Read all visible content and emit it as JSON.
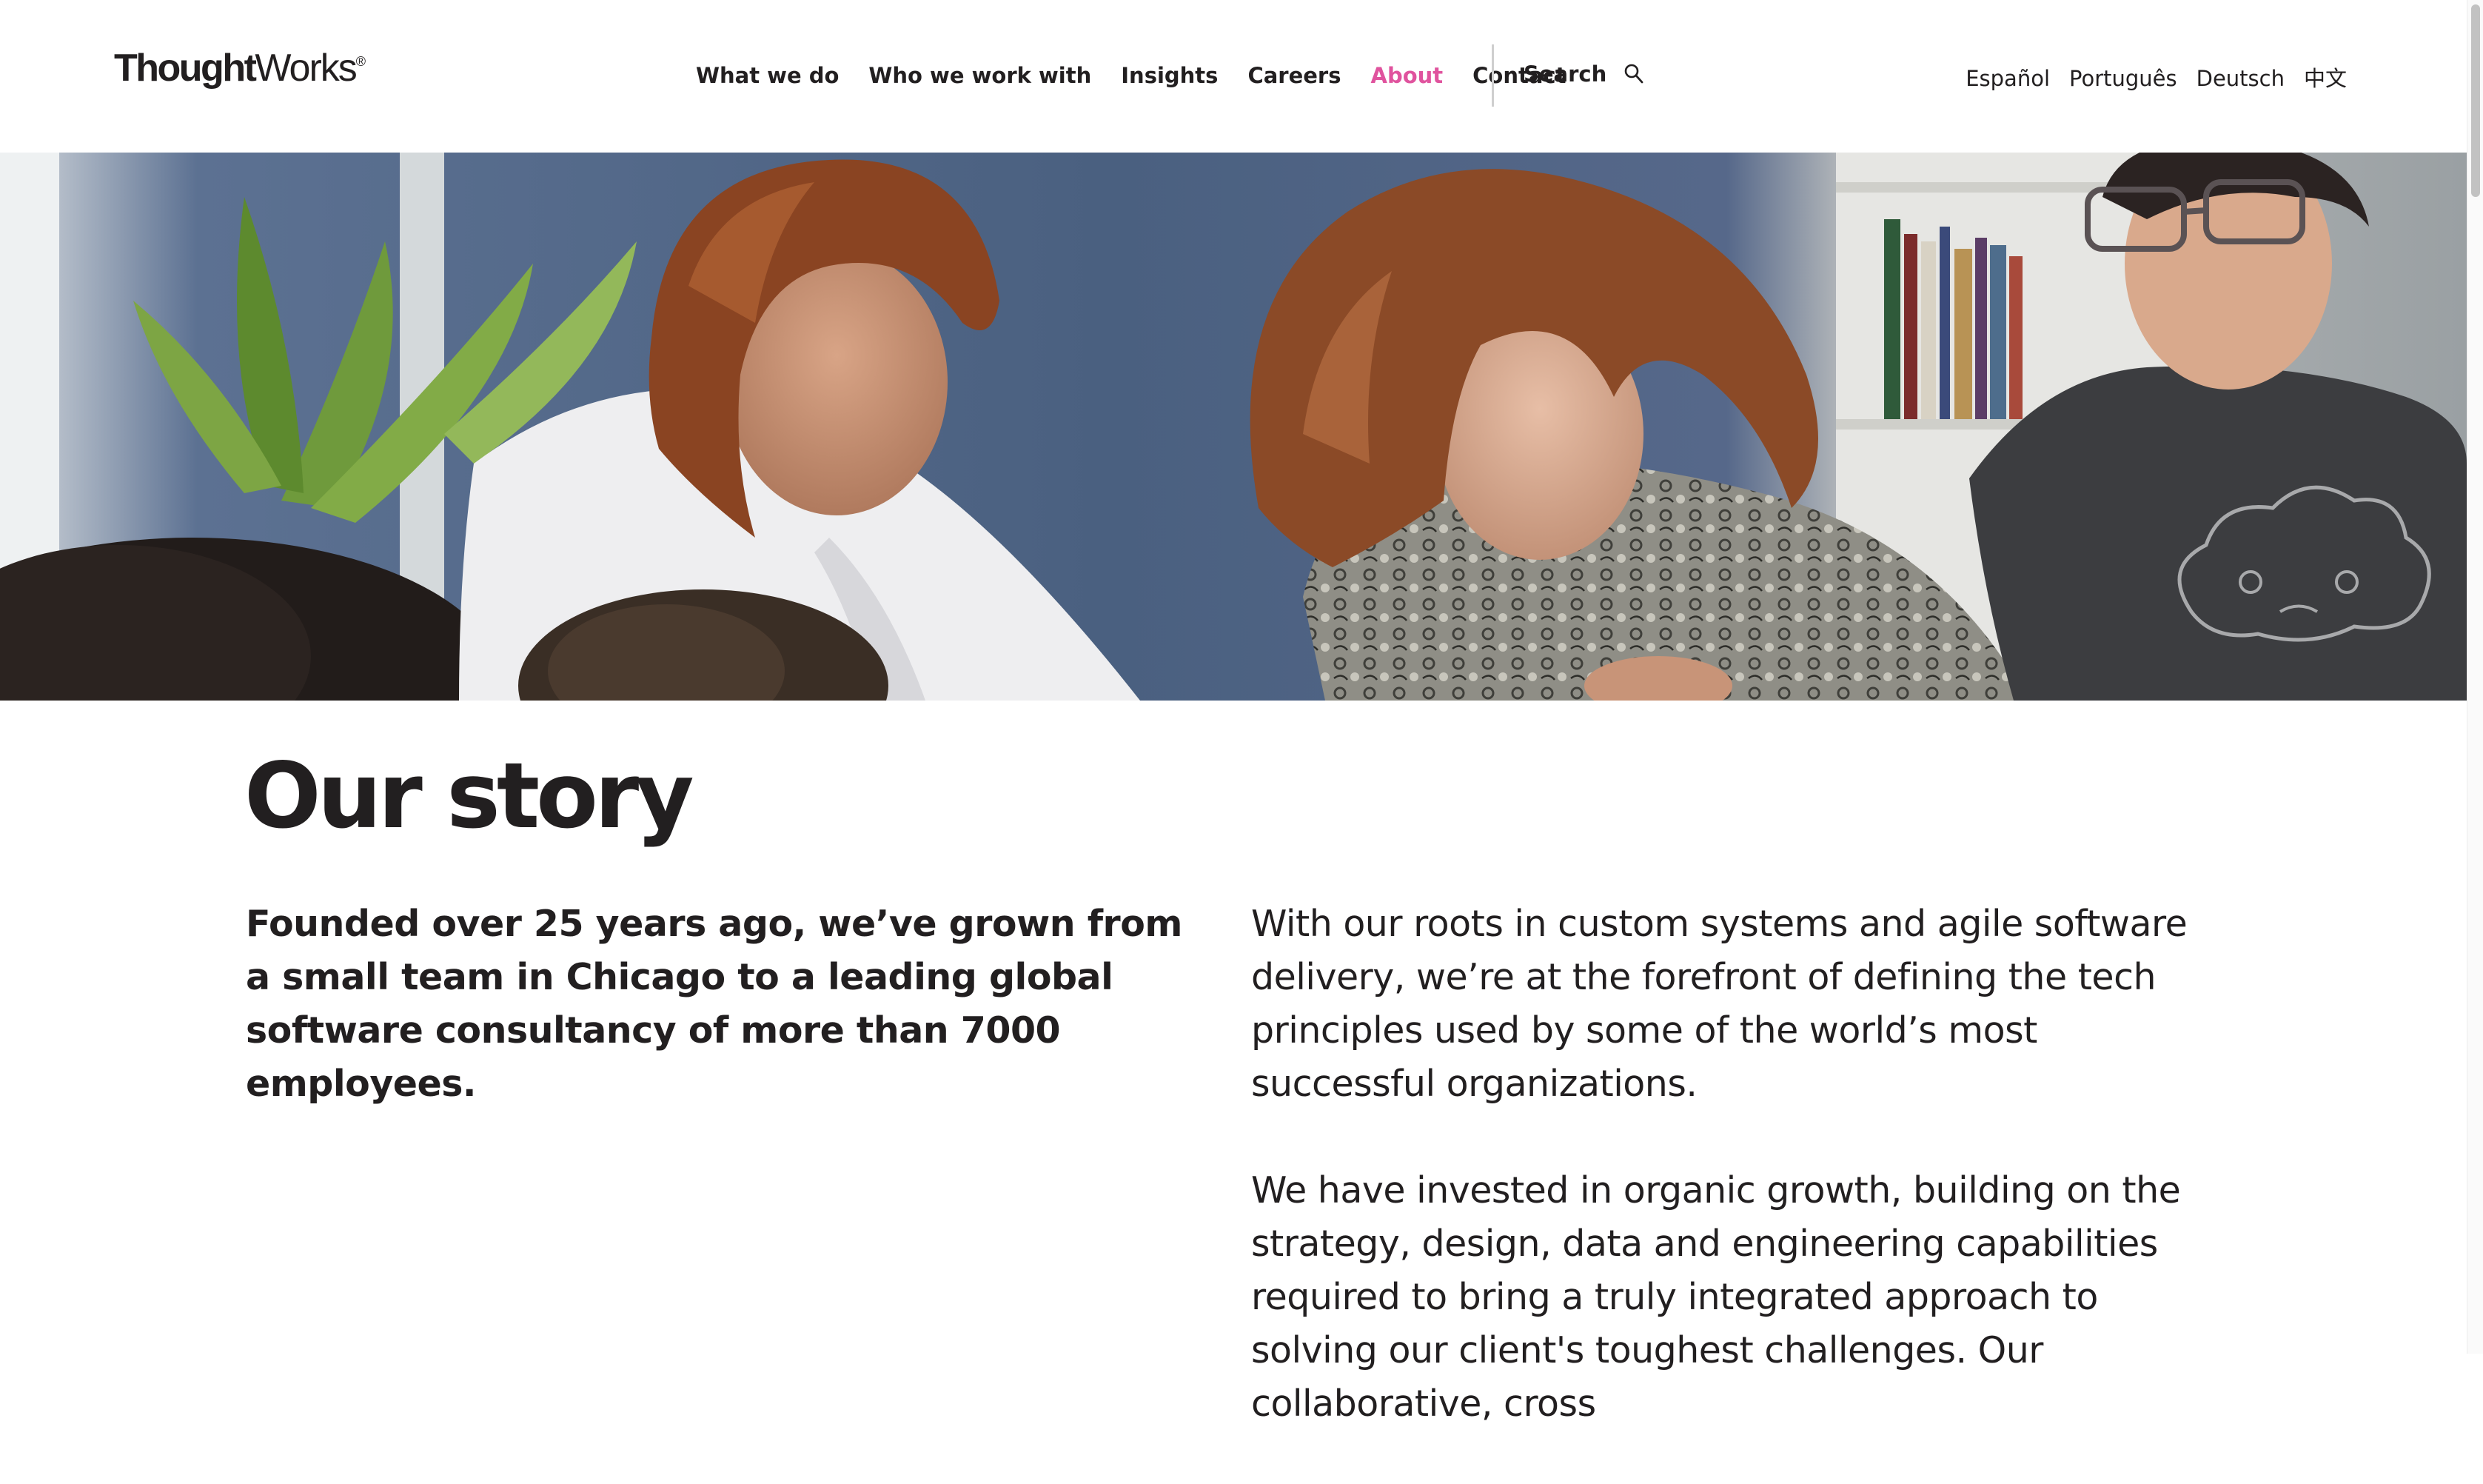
{
  "header": {
    "logo_bold": "Thought",
    "logo_light": "Works",
    "logo_mark": "®",
    "nav": [
      {
        "label": "What we do",
        "active": false
      },
      {
        "label": "Who we work with",
        "active": false
      },
      {
        "label": "Insights",
        "active": false
      },
      {
        "label": "Careers",
        "active": false
      },
      {
        "label": "About",
        "active": true
      },
      {
        "label": "Contact",
        "active": false
      }
    ],
    "search_label": "Search",
    "search_icon": "search-icon",
    "languages": [
      "Español",
      "Português",
      "Deutsch",
      "中文"
    ]
  },
  "hero": {
    "image": "team-collaboration-photo"
  },
  "content": {
    "title": "Our story",
    "lead": "Founded over 25 years ago, we’ve grown from a small team in Chicago to a leading global software consultancy of more than 7000 employees.",
    "paragraphs": [
      "With our roots in custom systems and agile software delivery, we’re at the forefront of defining the tech principles used by some of the world’s most successful organizations.",
      "We have invested in organic growth, building on the strategy, design, data and engineering capabilities required to bring a truly integrated approach to solving our client's toughest challenges. Our collaborative, cross"
    ]
  },
  "colors": {
    "text": "#221f20",
    "active_nav": "#e0539e",
    "background": "#ffffff"
  }
}
